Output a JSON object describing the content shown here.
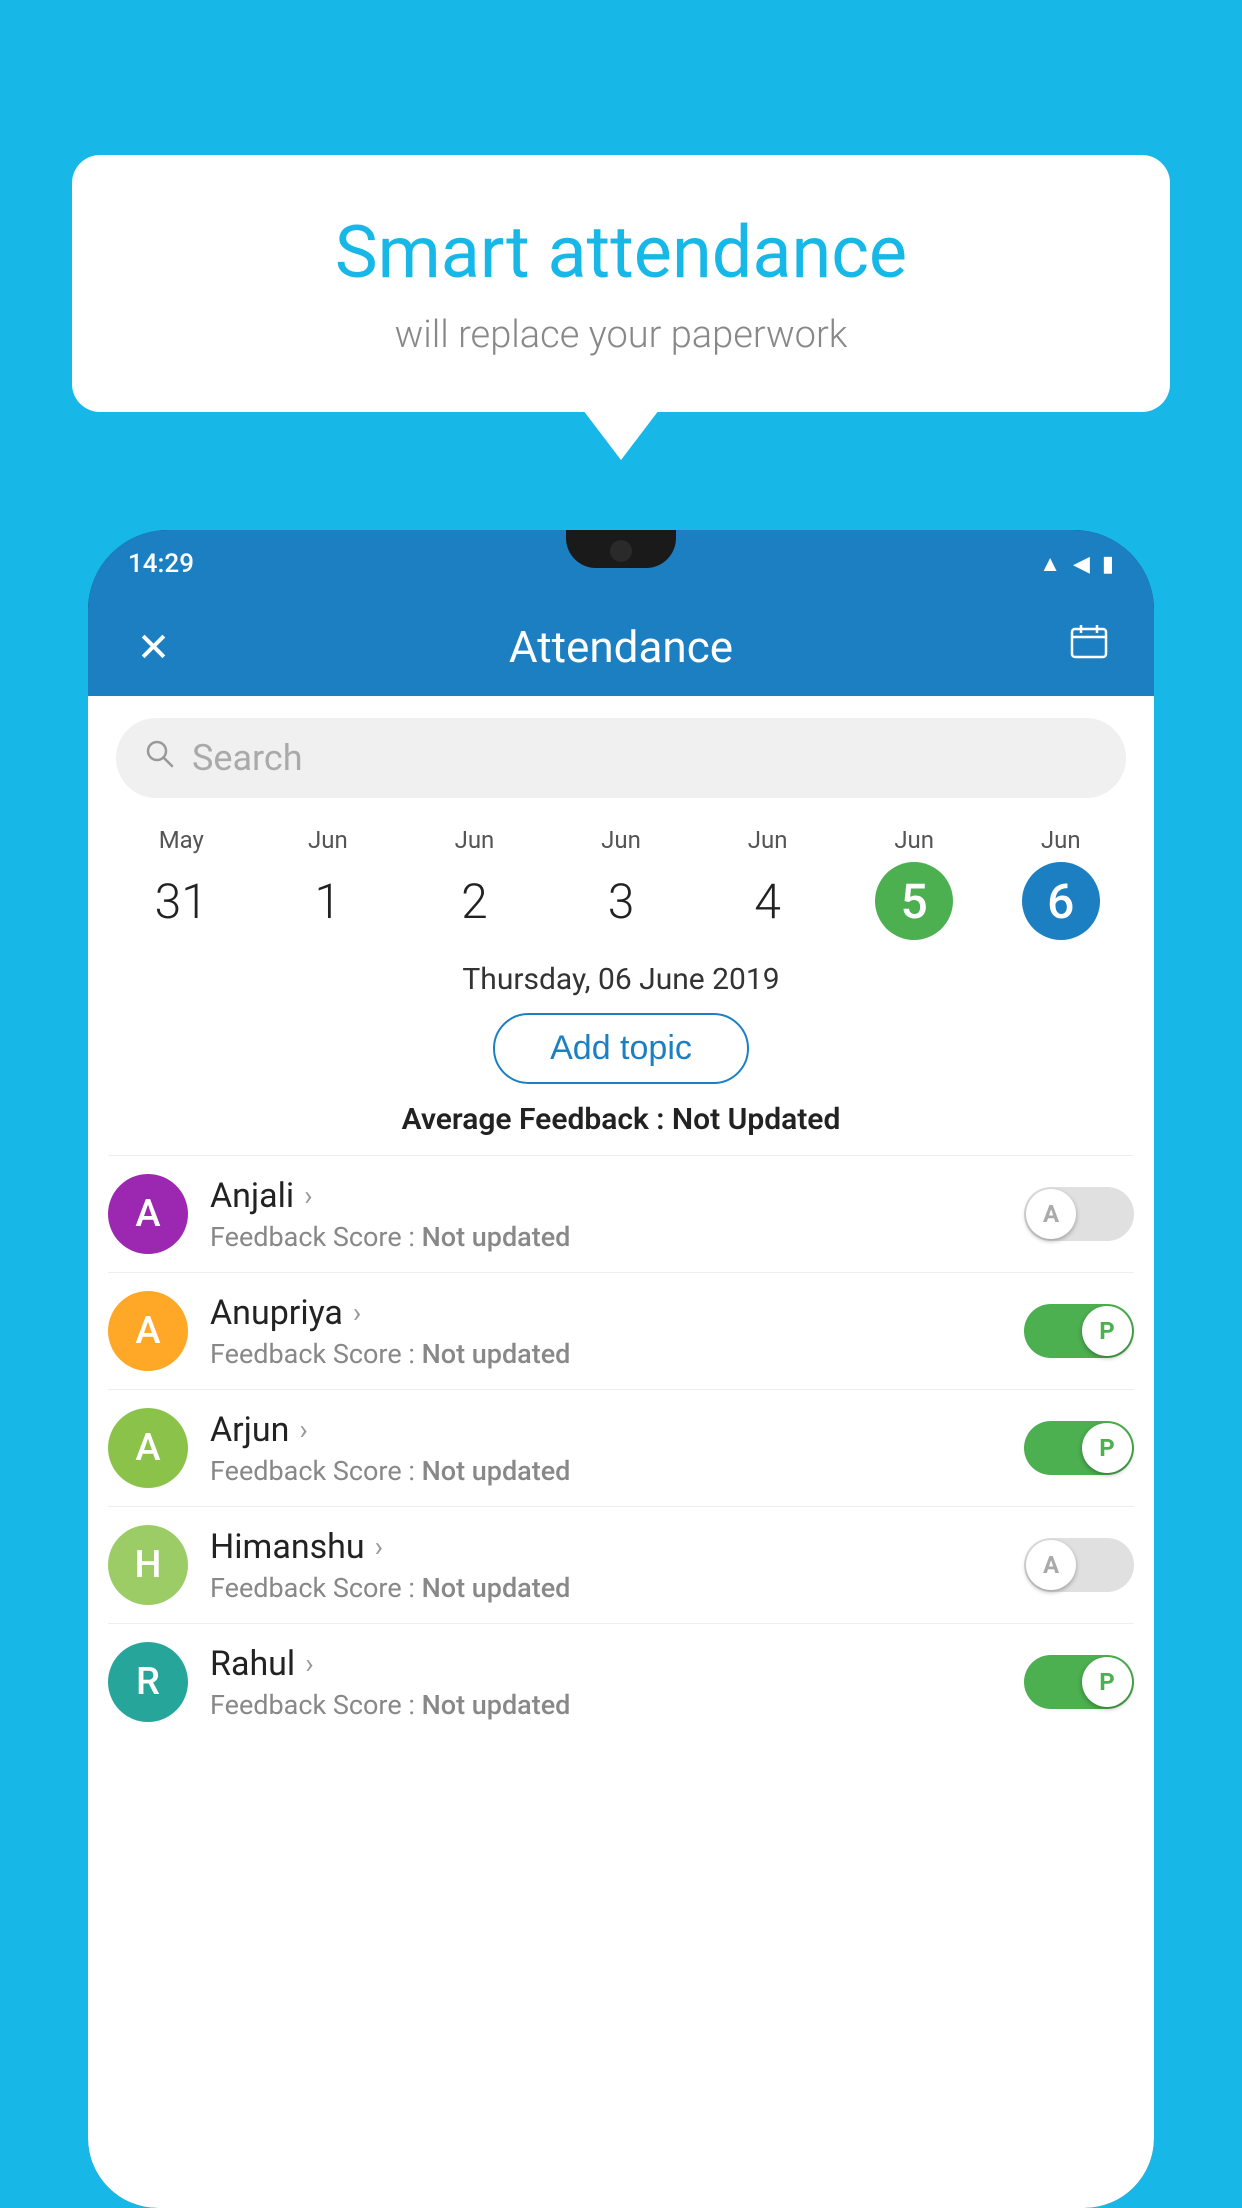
{
  "background_color": "#17b8e8",
  "bubble": {
    "title": "Smart attendance",
    "subtitle": "will replace your paperwork"
  },
  "status_bar": {
    "time": "14:29",
    "icons": [
      "wifi",
      "signal",
      "battery"
    ]
  },
  "app_bar": {
    "title": "Attendance",
    "close_label": "×",
    "calendar_icon": "📅"
  },
  "search": {
    "placeholder": "Search"
  },
  "calendar": {
    "months": [
      "May",
      "Jun",
      "Jun",
      "Jun",
      "Jun",
      "Jun",
      "Jun"
    ],
    "days": [
      "31",
      "1",
      "2",
      "3",
      "4",
      "5",
      "6"
    ],
    "states": [
      "normal",
      "normal",
      "normal",
      "normal",
      "normal",
      "today",
      "selected"
    ]
  },
  "selected_date": "Thursday, 06 June 2019",
  "add_topic_label": "Add topic",
  "avg_feedback_label": "Average Feedback :",
  "avg_feedback_value": "Not Updated",
  "students": [
    {
      "name": "Anjali",
      "initial": "A",
      "avatar_color": "#9c27b0",
      "feedback": "Not updated",
      "status": "absent",
      "toggle_label": "A"
    },
    {
      "name": "Anupriya",
      "initial": "A",
      "avatar_color": "#ffa726",
      "feedback": "Not updated",
      "status": "present",
      "toggle_label": "P"
    },
    {
      "name": "Arjun",
      "initial": "A",
      "avatar_color": "#8bc34a",
      "feedback": "Not updated",
      "status": "present",
      "toggle_label": "P"
    },
    {
      "name": "Himanshu",
      "initial": "H",
      "avatar_color": "#9ccc65",
      "feedback": "Not updated",
      "status": "absent",
      "toggle_label": "A"
    },
    {
      "name": "Rahul",
      "initial": "R",
      "avatar_color": "#26a69a",
      "feedback": "Not updated",
      "status": "present",
      "toggle_label": "P"
    }
  ],
  "feedback_score_label": "Feedback Score :"
}
